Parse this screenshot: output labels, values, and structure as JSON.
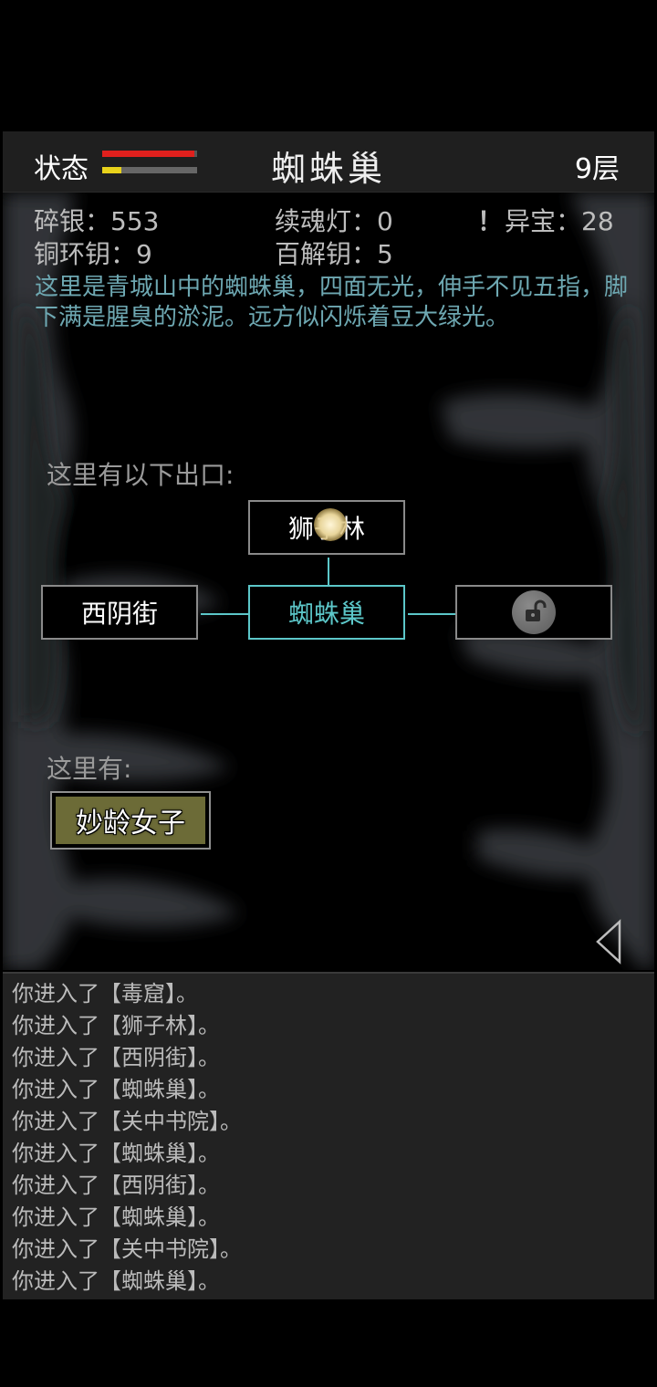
{
  "header": {
    "status_label": "状态",
    "room_title": "蜘蛛巢",
    "floor": "9层",
    "hp_fraction": 0.97,
    "energy_fraction": 0.2
  },
  "stats": {
    "silver": "碎银：553",
    "soul_lamp": "续魂灯：0",
    "alert_mark": "！",
    "treasure": "异宝：28",
    "copper_key": "铜环钥：9",
    "master_key": "百解钥：5"
  },
  "description": "这里是青城山中的蜘蛛巢，四面无光，伸手不见五指，脚下满是腥臭的淤泥。远方似闪烁着豆大绿光。",
  "exits": {
    "label": "这里有以下出口:",
    "north": "狮子林",
    "west": "西阴街",
    "center": "蜘蛛巢",
    "east_icon": "unlock-icon"
  },
  "here": {
    "label": "这里有:",
    "npc": "妙龄女子"
  },
  "log": [
    "你进入了【毒窟】。",
    "你进入了【狮子林】。",
    "你进入了【西阴街】。",
    "你进入了【蜘蛛巢】。",
    "你进入了【关中书院】。",
    "你进入了【蜘蛛巢】。",
    "你进入了【西阴街】。",
    "你进入了【蜘蛛巢】。",
    "你进入了【关中书院】。",
    "你进入了【蜘蛛巢】。"
  ],
  "colors": {
    "accent": "#5cc7c9",
    "hp": "#e0201d",
    "energy": "#e8d21b",
    "description": "#6ea8b2",
    "npc_bg": "#6c6b37"
  }
}
